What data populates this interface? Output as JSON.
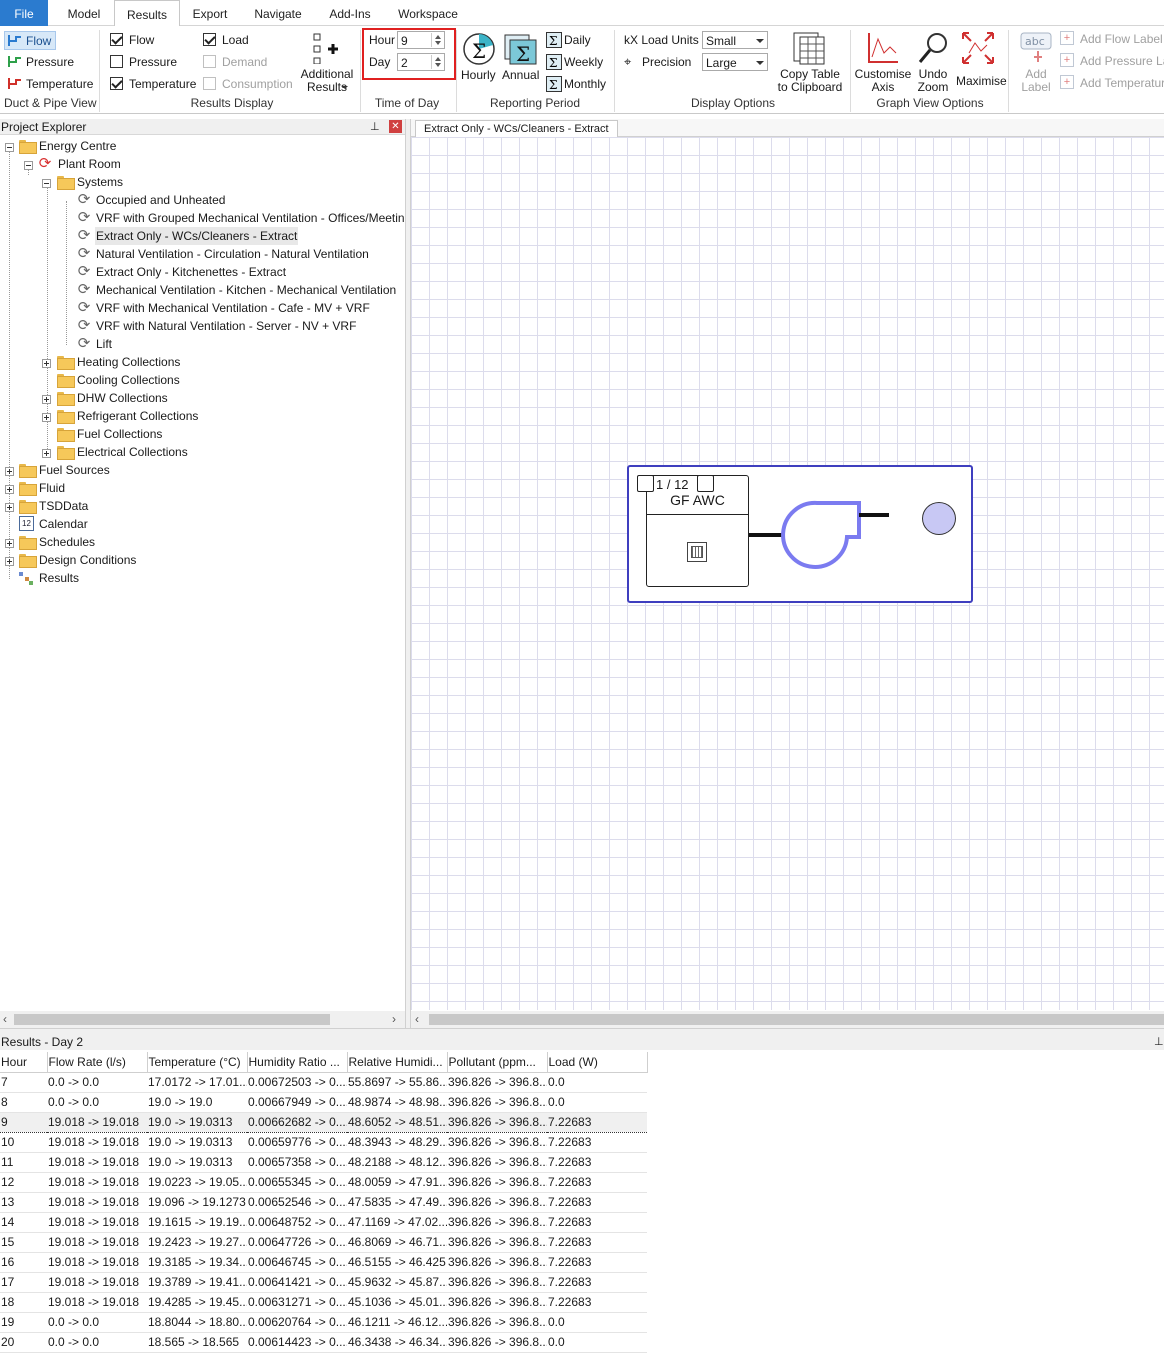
{
  "menubar": {
    "tabs": [
      "File",
      "Model",
      "Results",
      "Export",
      "Navigate",
      "Add-Ins",
      "Workspace"
    ],
    "active": "Results"
  },
  "ribbon": {
    "duct_pipe_view": {
      "group_label": "Duct & Pipe View",
      "items": [
        "Flow",
        "Pressure",
        "Temperature"
      ]
    },
    "results_display": {
      "group_label": "Results Display",
      "flow": {
        "label": "Flow",
        "checked": true
      },
      "pressure": {
        "label": "Pressure",
        "checked": false
      },
      "temperature": {
        "label": "Temperature",
        "checked": true
      },
      "load": {
        "label": "Load",
        "checked": true
      },
      "demand": {
        "label": "Demand",
        "checked": false
      },
      "consumption": {
        "label": "Consumption",
        "checked": false
      },
      "additional": "Additional Results"
    },
    "time_of_day": {
      "group_label": "Time of Day",
      "hour_label": "Hour",
      "hour_value": "9",
      "day_label": "Day",
      "day_value": "2",
      "highlight_color": "#e02020"
    },
    "reporting_period": {
      "group_label": "Reporting Period",
      "hourly": "Hourly",
      "annual": "Annual",
      "daily": "Daily",
      "weekly": "Weekly",
      "monthly": "Monthly"
    },
    "display_options": {
      "group_label": "Display Options",
      "kx_load_units": "kX Load Units",
      "precision": "Precision",
      "load_units_value": "Small",
      "precision_value": "Large",
      "copy_table": "Copy Table to Clipboard"
    },
    "graph_view_options": {
      "group_label": "Graph View Options",
      "customise_axis": "Customise Axis",
      "undo_zoom": "Undo Zoom",
      "maximise": "Maximise"
    },
    "labels": {
      "add_label": "Add Label",
      "add_flow_label": "Add Flow Label",
      "add_pressure_label": "Add Pressure Label",
      "add_temperature_label": "Add Temperature Label"
    }
  },
  "explorer": {
    "title": "Project Explorer",
    "nodes": [
      "Energy Centre",
      "Plant Room",
      "Systems",
      "Occupied and Unheated",
      "VRF with Grouped Mechanical Ventilation - Offices/Meeting",
      "Extract Only - WCs/Cleaners - Extract",
      "Natural Ventilation - Circulation - Natural Ventilation",
      "Extract Only - Kitchenettes - Extract",
      "Mechanical Ventilation - Kitchen - Mechanical Ventilation",
      "VRF with Mechanical Ventilation - Cafe - MV + VRF",
      "VRF with Natural Ventilation - Server - NV + VRF",
      "Lift",
      "Heating Collections",
      "Cooling Collections",
      "DHW Collections",
      "Refrigerant Collections",
      "Fuel Collections",
      "Electrical Collections",
      "Fuel Sources",
      "Fluid",
      "TSDData",
      "Calendar",
      "Schedules",
      "Design Conditions",
      "Results"
    ],
    "selected": "Extract Only - WCs/Cleaners - Extract"
  },
  "canvas": {
    "tab_title": "Extract Only - WCs/Cleaners - Extract",
    "component": {
      "counter": "1 / 12",
      "name": "GF AWC"
    }
  },
  "results": {
    "title": "Results - Day 2",
    "columns": [
      "Hour",
      "Flow Rate (l/s)",
      "Temperature (°C)",
      "Humidity Ratio ...",
      "Relative Humidi...",
      "Pollutant (ppm...",
      "Load (W)"
    ],
    "selected_hour": "9",
    "rows": [
      [
        "7",
        "0.0 -> 0.0",
        "17.0172 -> 17.01...",
        "0.00672503 -> 0....",
        "55.8697 -> 55.86...",
        "396.826 -> 396.8...",
        "0.0"
      ],
      [
        "8",
        "0.0 -> 0.0",
        "19.0 -> 19.0",
        "0.00667949 -> 0....",
        "48.9874 -> 48.98...",
        "396.826 -> 396.8...",
        "0.0"
      ],
      [
        "9",
        "19.018 -> 19.018",
        "19.0 -> 19.0313",
        "0.00662682 -> 0....",
        "48.6052 -> 48.51...",
        "396.826 -> 396.8...",
        "7.22683"
      ],
      [
        "10",
        "19.018 -> 19.018",
        "19.0 -> 19.0313",
        "0.00659776 -> 0....",
        "48.3943 -> 48.29...",
        "396.826 -> 396.8...",
        "7.22683"
      ],
      [
        "11",
        "19.018 -> 19.018",
        "19.0 -> 19.0313",
        "0.00657358 -> 0....",
        "48.2188 -> 48.12...",
        "396.826 -> 396.8...",
        "7.22683"
      ],
      [
        "12",
        "19.018 -> 19.018",
        "19.0223 -> 19.05...",
        "0.00655345 -> 0....",
        "48.0059 -> 47.91...",
        "396.826 -> 396.8...",
        "7.22683"
      ],
      [
        "13",
        "19.018 -> 19.018",
        "19.096 -> 19.1273",
        "0.00652546 -> 0....",
        "47.5835 -> 47.49...",
        "396.826 -> 396.8...",
        "7.22683"
      ],
      [
        "14",
        "19.018 -> 19.018",
        "19.1615 -> 19.19...",
        "0.00648752 -> 0....",
        "47.1169 -> 47.02...",
        "396.826 -> 396.8...",
        "7.22683"
      ],
      [
        "15",
        "19.018 -> 19.018",
        "19.2423 -> 19.27...",
        "0.00647726 -> 0....",
        "46.8069 -> 46.71...",
        "396.826 -> 396.8...",
        "7.22683"
      ],
      [
        "16",
        "19.018 -> 19.018",
        "19.3185 -> 19.34...",
        "0.00646745 -> 0....",
        "46.5155 -> 46.425",
        "396.826 -> 396.8...",
        "7.22683"
      ],
      [
        "17",
        "19.018 -> 19.018",
        "19.3789 -> 19.41...",
        "0.00641421 -> 0....",
        "45.9632 -> 45.87...",
        "396.826 -> 396.8...",
        "7.22683"
      ],
      [
        "18",
        "19.018 -> 19.018",
        "19.4285 -> 19.45...",
        "0.00631271 -> 0....",
        "45.1036 -> 45.01...",
        "396.826 -> 396.8...",
        "7.22683"
      ],
      [
        "19",
        "0.0 -> 0.0",
        "18.8044 -> 18.80...",
        "0.00620764 -> 0....",
        "46.1211 -> 46.12...",
        "396.826 -> 396.8...",
        "0.0"
      ],
      [
        "20",
        "0.0 -> 0.0",
        "18.565 -> 18.565",
        "0.00614423 -> 0....",
        "46.3438 -> 46.34...",
        "396.826 -> 396.8...",
        "0.0"
      ]
    ]
  }
}
